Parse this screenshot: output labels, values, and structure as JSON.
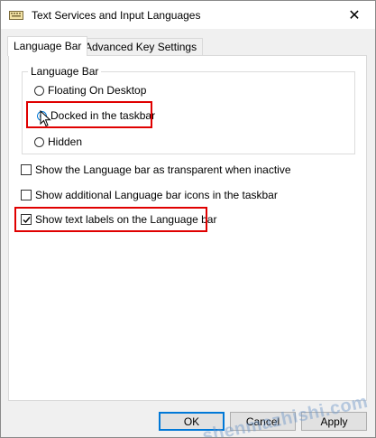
{
  "window": {
    "title": "Text Services and Input Languages",
    "close_glyph": "✕"
  },
  "tabs": [
    {
      "label": "Language Bar",
      "active": true
    },
    {
      "label": "Advanced Key Settings",
      "active": false
    }
  ],
  "language_bar_group": {
    "legend": "Language Bar",
    "options": [
      {
        "label": "Floating On Desktop",
        "selected": false
      },
      {
        "label": "Docked in the taskbar",
        "selected": true
      },
      {
        "label": "Hidden",
        "selected": false
      }
    ]
  },
  "checkboxes": [
    {
      "label": "Show the Language bar as transparent when inactive",
      "checked": false
    },
    {
      "label": "Show additional Language bar icons in the taskbar",
      "checked": false
    },
    {
      "label": "Show text labels on the Language bar",
      "checked": true
    }
  ],
  "buttons": {
    "ok": "OK",
    "cancel": "Cancel",
    "apply": "Apply"
  },
  "watermark": "shenmazhishi.com",
  "colors": {
    "accent": "#0078d7",
    "highlight": "#e00000"
  }
}
